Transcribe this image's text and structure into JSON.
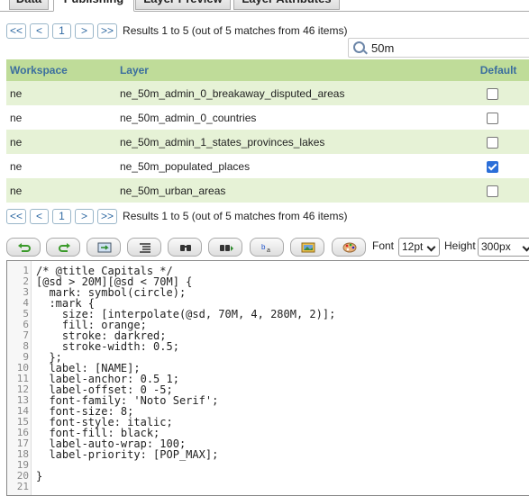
{
  "tabs": [
    {
      "label": "Data",
      "active": false
    },
    {
      "label": "Publishing",
      "active": true
    },
    {
      "label": "Layer Preview",
      "active": false
    },
    {
      "label": "Layer Attributes",
      "active": false
    }
  ],
  "pager": {
    "first": "<<",
    "prev": "<",
    "page": "1",
    "next": ">",
    "last": ">>",
    "info": "Results 1 to 5 (out of 5 matches from 46 items)"
  },
  "search": {
    "value": "50m",
    "icon": "search-icon"
  },
  "table": {
    "headers": [
      "Workspace",
      "Layer",
      "Default"
    ],
    "rows": [
      {
        "workspace": "ne",
        "layer": "ne_50m_admin_0_breakaway_disputed_areas",
        "default": false
      },
      {
        "workspace": "ne",
        "layer": "ne_50m_admin_0_countries",
        "default": false
      },
      {
        "workspace": "ne",
        "layer": "ne_50m_admin_1_states_provinces_lakes",
        "default": false
      },
      {
        "workspace": "ne",
        "layer": "ne_50m_populated_places",
        "default": true
      },
      {
        "workspace": "ne",
        "layer": "ne_50m_urban_areas",
        "default": false
      }
    ]
  },
  "toolbar": {
    "icons": [
      "undo-icon",
      "redo-icon",
      "go-to-line-icon",
      "reformat-icon",
      "find-icon",
      "replace-icon",
      "color-text-icon",
      "image-icon",
      "palette-icon"
    ],
    "font_label": "Font",
    "font_value": "12pt",
    "height_label": "Height",
    "height_value": "300px"
  },
  "editor": {
    "line_numbers": [
      "1",
      "2",
      "3",
      "4",
      "5",
      "6",
      "7",
      "8",
      "9",
      "10",
      "11",
      "12",
      "13",
      "14",
      "15",
      "16",
      "17",
      "18",
      "19",
      "20",
      "21"
    ],
    "lines": [
      "/* @title Capitals */",
      "[@sd > 20M][@sd < 70M] {",
      "  mark: symbol(circle);",
      "  :mark {",
      "    size: [interpolate(@sd, 70M, 4, 280M, 2)];",
      "    fill: orange;",
      "    stroke: darkred;",
      "    stroke-width: 0.5;",
      "  };",
      "  label: [NAME];",
      "  label-anchor: 0.5 1;",
      "  label-offset: 0 -5;",
      "  font-family: 'Noto Serif';",
      "  font-size: 8;",
      "  font-style: italic;",
      "  font-fill: black;",
      "  label-auto-wrap: 100;",
      "  label-priority: [POP_MAX];",
      "",
      "}",
      ""
    ]
  },
  "colors": {
    "header_bg": "#bfdc99",
    "header_text": "#3b6e9e",
    "row_odd": "#e6f2d6",
    "link_blue": "#2f69a2",
    "checkbox_on": "#2b6ed8"
  }
}
